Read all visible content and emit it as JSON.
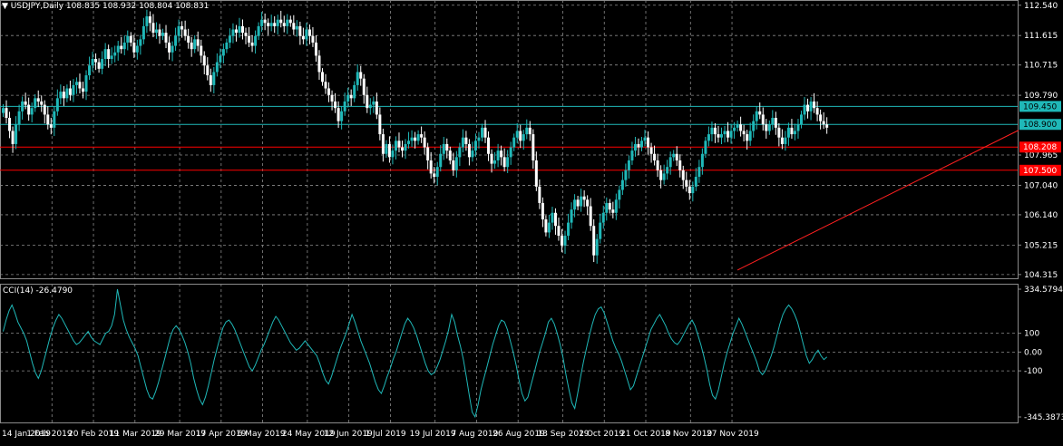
{
  "chart_data": [
    {
      "type": "candlestick",
      "symbol_label": "USDJPY,Daily",
      "ohlc_label": "108.835 108.932 108.804 108.831",
      "ylim": [
        104.2,
        112.7
      ],
      "y_ticks": [
        {
          "value": 112.54,
          "label": "112.540"
        },
        {
          "value": 111.615,
          "label": "111.615"
        },
        {
          "value": 110.715,
          "label": "110.715"
        },
        {
          "value": 109.79,
          "label": "109.790"
        },
        {
          "value": 107.965,
          "label": "107.965"
        },
        {
          "value": 107.04,
          "label": "107.040"
        },
        {
          "value": 106.14,
          "label": "106.140"
        },
        {
          "value": 105.215,
          "label": "105.215"
        },
        {
          "value": 104.315,
          "label": "104.315"
        }
      ],
      "horizontal_levels": [
        {
          "value": 109.45,
          "label": "109.450",
          "color": "#1fb8b8"
        },
        {
          "value": 108.9,
          "label": "108.900",
          "color": "#1fb8b8"
        },
        {
          "value": 108.208,
          "label": "108.208",
          "color": "#ff0000"
        },
        {
          "value": 107.5,
          "label": "107.500",
          "color": "#ff0000"
        }
      ],
      "trendline": {
        "from": {
          "bar": 230,
          "price": 104.45
        },
        "to": {
          "bar": 318,
          "price": 108.72
        },
        "color": "#ff2020"
      },
      "closes": [
        109.4,
        109.1,
        108.7,
        108.3,
        108.9,
        109.3,
        109.6,
        109.5,
        109.2,
        109.4,
        109.7,
        109.6,
        109.5,
        109.2,
        108.9,
        108.8,
        109.3,
        109.7,
        109.9,
        109.7,
        110.0,
        109.8,
        110.1,
        110.2,
        110.0,
        109.9,
        110.4,
        110.7,
        110.9,
        110.8,
        110.6,
        110.9,
        111.2,
        110.9,
        111.0,
        111.1,
        111.3,
        111.2,
        111.4,
        111.6,
        111.4,
        111.1,
        111.3,
        111.5,
        111.9,
        112.2,
        112.0,
        111.7,
        111.8,
        111.6,
        111.7,
        111.4,
        111.1,
        111.3,
        111.6,
        111.9,
        111.8,
        111.6,
        111.4,
        111.2,
        111.5,
        111.3,
        111.0,
        110.7,
        110.4,
        110.1,
        110.5,
        110.8,
        111.0,
        111.2,
        111.4,
        111.6,
        111.8,
        111.7,
        111.9,
        111.7,
        111.6,
        111.4,
        111.3,
        111.6,
        111.9,
        112.1,
        112.0,
        111.9,
        112.0,
        111.9,
        112.1,
        112.0,
        111.9,
        112.1,
        112.0,
        111.8,
        111.9,
        111.6,
        111.5,
        111.8,
        111.6,
        111.4,
        111.0,
        110.5,
        110.2,
        110.0,
        109.8,
        109.6,
        109.4,
        109.0,
        109.3,
        109.6,
        109.8,
        109.7,
        110.1,
        110.5,
        110.3,
        109.8,
        109.4,
        109.5,
        109.6,
        109.2,
        108.6,
        108.0,
        108.3,
        107.9,
        108.1,
        108.4,
        108.2,
        108.1,
        108.3,
        108.4,
        108.5,
        108.4,
        108.6,
        108.5,
        108.2,
        107.8,
        107.4,
        107.3,
        107.6,
        108.0,
        108.3,
        108.1,
        107.8,
        107.5,
        107.9,
        108.2,
        108.5,
        108.3,
        107.9,
        108.1,
        108.4,
        108.5,
        108.8,
        108.5,
        108.0,
        107.7,
        107.8,
        108.1,
        107.9,
        107.6,
        107.9,
        108.2,
        108.5,
        108.7,
        108.4,
        108.6,
        108.8,
        108.6,
        107.8,
        107.0,
        106.5,
        106.0,
        105.6,
        105.9,
        106.2,
        105.8,
        105.5,
        105.2,
        105.5,
        105.9,
        106.3,
        106.6,
        106.4,
        106.7,
        106.6,
        106.4,
        105.8,
        104.9,
        105.4,
        105.9,
        106.2,
        106.5,
        106.3,
        106.2,
        106.6,
        106.9,
        107.2,
        107.5,
        107.8,
        108.1,
        108.3,
        108.2,
        108.4,
        108.5,
        108.2,
        108.0,
        107.8,
        107.5,
        107.2,
        107.4,
        107.6,
        107.9,
        108.0,
        107.8,
        107.5,
        107.2,
        107.0,
        106.8,
        107.0,
        107.3,
        107.6,
        108.0,
        108.4,
        108.6,
        108.8,
        108.6,
        108.5,
        108.6,
        108.7,
        108.5,
        108.7,
        108.8,
        108.9,
        108.7,
        108.6,
        108.4,
        108.7,
        109.0,
        109.3,
        109.2,
        108.9,
        108.7,
        108.9,
        109.1,
        108.8,
        108.5,
        108.3,
        108.5,
        108.8,
        108.6,
        108.7,
        108.9,
        109.2,
        109.5,
        109.3,
        109.6,
        109.4,
        109.2,
        109.0,
        108.9,
        108.8
      ]
    },
    {
      "type": "line",
      "name": "CCI(14)",
      "title": "CCI(14) -26.4790",
      "ylim": [
        -345.3873,
        334.5794
      ],
      "y_ticks": [
        {
          "value": 334.5794,
          "label": "334.5794"
        },
        {
          "value": 100,
          "label": "100"
        },
        {
          "value": 0,
          "label": "0.00"
        },
        {
          "value": -100,
          "label": "-100"
        },
        {
          "value": -345.3873,
          "label": "-345.3873"
        }
      ],
      "color": "#1fb8b8",
      "values": [
        110,
        170,
        220,
        250,
        210,
        160,
        130,
        100,
        60,
        0,
        -60,
        -110,
        -140,
        -100,
        -40,
        20,
        80,
        130,
        170,
        200,
        180,
        150,
        120,
        90,
        60,
        40,
        50,
        70,
        90,
        110,
        80,
        60,
        50,
        40,
        70,
        100,
        110,
        140,
        200,
        334,
        250,
        170,
        120,
        80,
        50,
        20,
        -20,
        -80,
        -140,
        -200,
        -240,
        -250,
        -210,
        -160,
        -100,
        -40,
        20,
        80,
        120,
        140,
        120,
        90,
        50,
        0,
        -60,
        -140,
        -200,
        -250,
        -280,
        -240,
        -180,
        -110,
        -40,
        20,
        80,
        130,
        160,
        170,
        150,
        120,
        80,
        40,
        0,
        -40,
        -80,
        -100,
        -70,
        -30,
        10,
        40,
        80,
        120,
        160,
        190,
        170,
        140,
        110,
        80,
        50,
        30,
        10,
        20,
        40,
        60,
        40,
        20,
        0,
        -20,
        -60,
        -110,
        -150,
        -170,
        -130,
        -80,
        -30,
        20,
        60,
        100,
        150,
        200,
        160,
        110,
        60,
        20,
        -20,
        -60,
        -110,
        -160,
        -200,
        -220,
        -180,
        -130,
        -90,
        -40,
        0,
        50,
        100,
        150,
        180,
        160,
        130,
        90,
        40,
        -10,
        -60,
        -100,
        -120,
        -110,
        -80,
        -40,
        10,
        60,
        120,
        200,
        160,
        90,
        30,
        -40,
        -130,
        -230,
        -320,
        -345,
        -280,
        -200,
        -140,
        -80,
        -20,
        40,
        90,
        140,
        170,
        160,
        120,
        60,
        0,
        -70,
        -150,
        -220,
        -260,
        -240,
        -180,
        -120,
        -60,
        0,
        50,
        100,
        160,
        180,
        150,
        100,
        40,
        -30,
        -120,
        -200,
        -270,
        -300,
        -220,
        -130,
        -50,
        20,
        90,
        150,
        200,
        230,
        240,
        210,
        160,
        110,
        60,
        20,
        -10,
        -50,
        -100,
        -150,
        -200,
        -180,
        -130,
        -80,
        -30,
        20,
        70,
        120,
        150,
        180,
        200,
        170,
        140,
        100,
        70,
        50,
        40,
        60,
        90,
        120,
        150,
        170,
        140,
        90,
        40,
        -20,
        -90,
        -170,
        -230,
        -250,
        -200,
        -130,
        -60,
        0,
        50,
        100,
        140,
        180,
        150,
        110,
        70,
        30,
        -10,
        -50,
        -100,
        -120,
        -100,
        -60,
        -20,
        30,
        90,
        150,
        200,
        230,
        250,
        230,
        200,
        160,
        100,
        40,
        -20,
        -60,
        -40,
        -10,
        10,
        -20,
        -40,
        -26
      ]
    }
  ],
  "x_axis_labels": [
    {
      "bar": 0,
      "label": "14 Jan 2019"
    },
    {
      "bar": 14,
      "label": "1 Feb 2019"
    },
    {
      "bar": 27,
      "label": "20 Feb 2019"
    },
    {
      "bar": 40,
      "label": "11 Mar 2019"
    },
    {
      "bar": 54,
      "label": "29 Mar 2019"
    },
    {
      "bar": 67,
      "label": "17 Apr 2019"
    },
    {
      "bar": 80,
      "label": "6 May 2019"
    },
    {
      "bar": 94,
      "label": "24 May 2019"
    },
    {
      "bar": 107,
      "label": "12 Jun 2019"
    },
    {
      "bar": 120,
      "label": "1 Jul 2019"
    },
    {
      "bar": 134,
      "label": "19 Jul 2019"
    },
    {
      "bar": 147,
      "label": "7 Aug 2019"
    },
    {
      "bar": 160,
      "label": "26 Aug 2019"
    },
    {
      "bar": 174,
      "label": "13 Sep 2019"
    },
    {
      "bar": 187,
      "label": "2 Oct 2019"
    },
    {
      "bar": 200,
      "label": "21 Oct 2019"
    },
    {
      "bar": 214,
      "label": "8 Nov 2019"
    },
    {
      "bar": 227,
      "label": "27 Nov 2019"
    }
  ],
  "colors": {
    "background": "#000000",
    "grid": "#8a8a8a",
    "bull": "#1fb8b8",
    "bear": "#ffffff",
    "text": "#ffffff",
    "separator": "#8a8a8a"
  }
}
